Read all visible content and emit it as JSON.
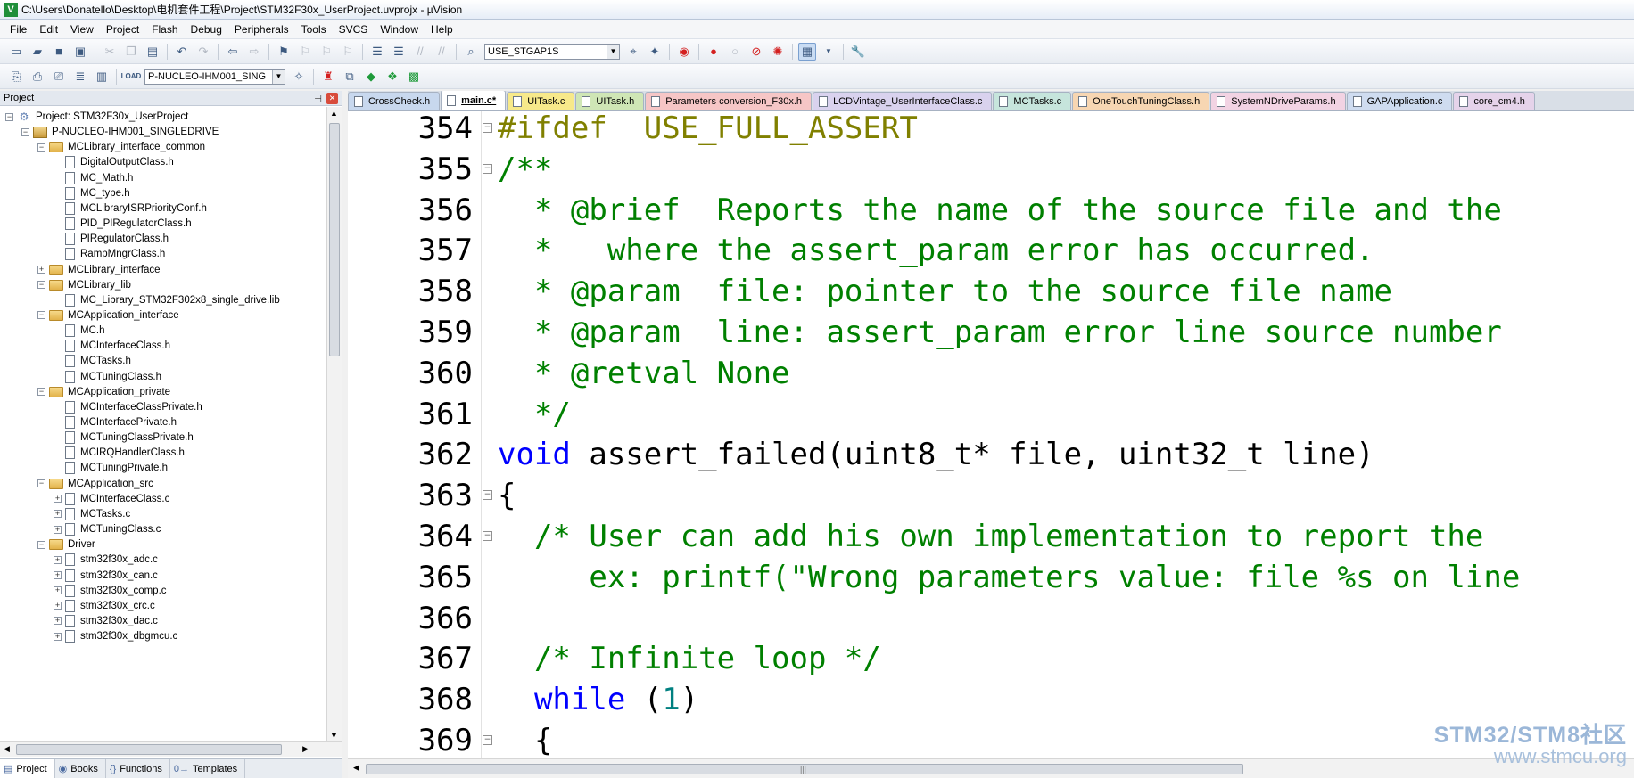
{
  "window": {
    "app_icon": "V",
    "title": "C:\\Users\\Donatello\\Desktop\\电机套件工程\\Project\\STM32F30x_UserProject.uvprojx - µVision"
  },
  "menu": [
    "File",
    "Edit",
    "View",
    "Project",
    "Flash",
    "Debug",
    "Peripherals",
    "Tools",
    "SVCS",
    "Window",
    "Help"
  ],
  "toolbar1": {
    "target_combo": "USE_STGAP1S"
  },
  "toolbar2": {
    "target_select": "P-NUCLEO-IHM001_SING",
    "load_label": "LOAD"
  },
  "project_pane": {
    "title": "Project",
    "tree": [
      {
        "label": "Project: STM32F30x_UserProject",
        "level": 0,
        "kind": "project",
        "expander": "-"
      },
      {
        "label": "P-NUCLEO-IHM001_SINGLEDRIVE",
        "level": 1,
        "kind": "target",
        "expander": "-"
      },
      {
        "label": "MCLibrary_interface_common",
        "level": 2,
        "kind": "folder",
        "expander": "-"
      },
      {
        "label": "DigitalOutputClass.h",
        "level": 3,
        "kind": "file",
        "expander": ""
      },
      {
        "label": "MC_Math.h",
        "level": 3,
        "kind": "file",
        "expander": ""
      },
      {
        "label": "MC_type.h",
        "level": 3,
        "kind": "file",
        "expander": ""
      },
      {
        "label": "MCLibraryISRPriorityConf.h",
        "level": 3,
        "kind": "file",
        "expander": ""
      },
      {
        "label": "PID_PIRegulatorClass.h",
        "level": 3,
        "kind": "file",
        "expander": ""
      },
      {
        "label": "PIRegulatorClass.h",
        "level": 3,
        "kind": "file",
        "expander": ""
      },
      {
        "label": "RampMngrClass.h",
        "level": 3,
        "kind": "file",
        "expander": ""
      },
      {
        "label": "MCLibrary_interface",
        "level": 2,
        "kind": "folder",
        "expander": "+"
      },
      {
        "label": "MCLibrary_lib",
        "level": 2,
        "kind": "folder",
        "expander": "-"
      },
      {
        "label": "MC_Library_STM32F302x8_single_drive.lib",
        "level": 3,
        "kind": "file",
        "expander": ""
      },
      {
        "label": "MCApplication_interface",
        "level": 2,
        "kind": "folder",
        "expander": "-"
      },
      {
        "label": "MC.h",
        "level": 3,
        "kind": "file",
        "expander": ""
      },
      {
        "label": "MCInterfaceClass.h",
        "level": 3,
        "kind": "file",
        "expander": ""
      },
      {
        "label": "MCTasks.h",
        "level": 3,
        "kind": "file",
        "expander": ""
      },
      {
        "label": "MCTuningClass.h",
        "level": 3,
        "kind": "file",
        "expander": ""
      },
      {
        "label": "MCApplication_private",
        "level": 2,
        "kind": "folder",
        "expander": "-"
      },
      {
        "label": "MCInterfaceClassPrivate.h",
        "level": 3,
        "kind": "file",
        "expander": ""
      },
      {
        "label": "MCInterfacePrivate.h",
        "level": 3,
        "kind": "file",
        "expander": ""
      },
      {
        "label": "MCTuningClassPrivate.h",
        "level": 3,
        "kind": "file",
        "expander": ""
      },
      {
        "label": "MCIRQHandlerClass.h",
        "level": 3,
        "kind": "file",
        "expander": ""
      },
      {
        "label": "MCTuningPrivate.h",
        "level": 3,
        "kind": "file",
        "expander": ""
      },
      {
        "label": "MCApplication_src",
        "level": 2,
        "kind": "folder",
        "expander": "-"
      },
      {
        "label": "MCInterfaceClass.c",
        "level": 3,
        "kind": "file",
        "expander": "+"
      },
      {
        "label": "MCTasks.c",
        "level": 3,
        "kind": "file",
        "expander": "+"
      },
      {
        "label": "MCTuningClass.c",
        "level": 3,
        "kind": "file",
        "expander": "+"
      },
      {
        "label": "Driver",
        "level": 2,
        "kind": "folder",
        "expander": "-"
      },
      {
        "label": "stm32f30x_adc.c",
        "level": 3,
        "kind": "file",
        "expander": "+"
      },
      {
        "label": "stm32f30x_can.c",
        "level": 3,
        "kind": "file",
        "expander": "+"
      },
      {
        "label": "stm32f30x_comp.c",
        "level": 3,
        "kind": "file",
        "expander": "+"
      },
      {
        "label": "stm32f30x_crc.c",
        "level": 3,
        "kind": "file",
        "expander": "+"
      },
      {
        "label": "stm32f30x_dac.c",
        "level": 3,
        "kind": "file",
        "expander": "+"
      },
      {
        "label": "stm32f30x_dbgmcu.c",
        "level": 3,
        "kind": "file",
        "expander": "+"
      }
    ],
    "bottom_tabs": [
      {
        "label": "Project",
        "icon": "project-icon",
        "glyph": "▤"
      },
      {
        "label": "Books",
        "icon": "books-icon",
        "glyph": "◉"
      },
      {
        "label": "Functions",
        "icon": "functions-icon",
        "glyph": "{}"
      },
      {
        "label": "Templates",
        "icon": "templates-icon",
        "glyph": "0→"
      }
    ]
  },
  "editor_tabs": [
    {
      "label": "CrossCheck.h",
      "color": "#c8d8ee",
      "active": false
    },
    {
      "label": "main.c*",
      "color": "#ffffff",
      "active": true
    },
    {
      "label": "UITask.c",
      "color": "#f7e98a",
      "active": false
    },
    {
      "label": "UITask.h",
      "color": "#cfe6b5",
      "active": false
    },
    {
      "label": "Parameters conversion_F30x.h",
      "color": "#f6c6c6",
      "active": false
    },
    {
      "label": "LCDVintage_UserInterfaceClass.c",
      "color": "#d9d2ee",
      "active": false
    },
    {
      "label": "MCTasks.c",
      "color": "#c6e5dc",
      "active": false
    },
    {
      "label": "OneTouchTuningClass.h",
      "color": "#f7d6b2",
      "active": false
    },
    {
      "label": "SystemNDriveParams.h",
      "color": "#f2d3e3",
      "active": false
    },
    {
      "label": "GAPApplication.c",
      "color": "#cfdcf0",
      "active": false
    },
    {
      "label": "core_cm4.h",
      "color": "#e5d3ea",
      "active": false
    }
  ],
  "code_lines": [
    {
      "no": "354",
      "fold": "-",
      "segments": [
        {
          "t": "#ifdef  USE_FULL_ASSERT",
          "c": "c-preproc"
        }
      ]
    },
    {
      "no": "355",
      "fold": "-",
      "segments": [
        {
          "t": "/**",
          "c": "c-comment"
        }
      ]
    },
    {
      "no": "356",
      "fold": "",
      "segments": [
        {
          "t": "  * @brief  Reports the name of the source file and the",
          "c": "c-comment"
        }
      ]
    },
    {
      "no": "357",
      "fold": "",
      "segments": [
        {
          "t": "  *   where the assert_param error has occurred.",
          "c": "c-comment"
        }
      ]
    },
    {
      "no": "358",
      "fold": "",
      "segments": [
        {
          "t": "  * @param  file: pointer to the source file name",
          "c": "c-comment"
        }
      ]
    },
    {
      "no": "359",
      "fold": "",
      "segments": [
        {
          "t": "  * @param  line: assert_param error line source number",
          "c": "c-comment"
        }
      ]
    },
    {
      "no": "360",
      "fold": "",
      "segments": [
        {
          "t": "  * @retval None",
          "c": "c-comment"
        }
      ]
    },
    {
      "no": "361",
      "fold": "",
      "segments": [
        {
          "t": "  */",
          "c": "c-comment"
        }
      ]
    },
    {
      "no": "362",
      "fold": "",
      "segments": [
        {
          "t": "void",
          "c": "c-keyword"
        },
        {
          "t": " assert_failed(uint8_t* file, uint32_t line)",
          "c": "c-normal"
        }
      ]
    },
    {
      "no": "363",
      "fold": "-",
      "segments": [
        {
          "t": "{",
          "c": "c-normal"
        }
      ]
    },
    {
      "no": "364",
      "fold": "-",
      "segments": [
        {
          "t": "  /* User can add his own implementation to report the",
          "c": "c-comment"
        }
      ]
    },
    {
      "no": "365",
      "fold": "",
      "segments": [
        {
          "t": "     ex: printf(\"Wrong parameters value: file %s on line",
          "c": "c-comment"
        }
      ]
    },
    {
      "no": "366",
      "fold": "",
      "segments": [
        {
          "t": "",
          "c": "c-normal"
        }
      ]
    },
    {
      "no": "367",
      "fold": "",
      "segments": [
        {
          "t": "  /* Infinite loop */",
          "c": "c-comment"
        }
      ]
    },
    {
      "no": "368",
      "fold": "",
      "segments": [
        {
          "t": "  ",
          "c": "c-normal"
        },
        {
          "t": "while",
          "c": "c-keyword"
        },
        {
          "t": " (",
          "c": "c-normal"
        },
        {
          "t": "1",
          "c": "c-number"
        },
        {
          "t": ")",
          "c": "c-normal"
        }
      ]
    },
    {
      "no": "369",
      "fold": "-",
      "segments": [
        {
          "t": "  {",
          "c": "c-normal"
        }
      ]
    }
  ],
  "watermark": {
    "line1": "STM32/STM8社区",
    "line2": "www.stmcu.org"
  }
}
